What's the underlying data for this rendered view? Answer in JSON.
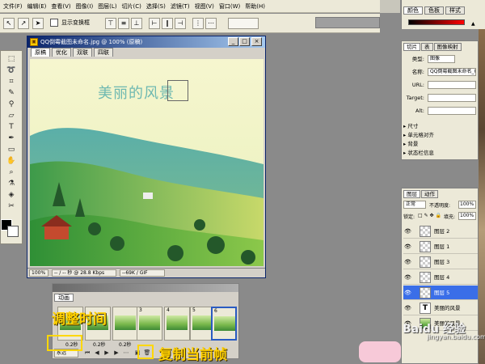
{
  "menubar": {
    "items": [
      "文件(F)",
      "编辑(E)",
      "查看(V)",
      "图像(I)",
      "图层(L)",
      "切片(C)",
      "选择(S)",
      "滤镜(T)",
      "视图(V)",
      "窗口(W)",
      "帮助(H)"
    ]
  },
  "options": {
    "checkbox_label": "显示变换框"
  },
  "document": {
    "title": "QQ倒霉截图未命名.jpg @ 100% (原稿)",
    "tabs": [
      "原稿",
      "优化",
      "双联",
      "四联"
    ],
    "canvas_text": "美丽的风景",
    "status": {
      "zoom": "100%",
      "time": "-- / -- 秒 @ 28.8 Kbps",
      "format": "--69K / GIF"
    }
  },
  "animation": {
    "tab_label": "动画",
    "frames": [
      {
        "num": "3",
        "delay": "0.2秒"
      },
      {
        "num": "4",
        "delay": "0.2秒"
      },
      {
        "num": "5",
        "delay": "0.2秒"
      },
      {
        "num": "6",
        "delay": "0.2秒"
      }
    ],
    "delays_visible": [
      "0.2秒",
      "0.2秒",
      "0.2秒"
    ],
    "loop_option": "永远"
  },
  "annotations": {
    "adjust_time": "调整时间",
    "duplicate_frame": "复制当前帧"
  },
  "color_panel": {
    "tabs": [
      "颜色",
      "色板",
      "样式"
    ]
  },
  "props_panel": {
    "tabs": [
      "切片",
      "表",
      "图像映射"
    ],
    "type_label": "类型:",
    "type_value": "图像",
    "name_label": "名称:",
    "name_value": "QQ倒霉截图未命名_01",
    "url_label": "URL:",
    "target_label": "Target:",
    "alt_label": "Alt:",
    "sections": [
      "尺寸",
      "单元格对齐",
      "背景",
      "状态栏信息"
    ]
  },
  "layers_panel": {
    "tabs": [
      "图层",
      "动作"
    ],
    "blend_mode": "正常",
    "opacity_label": "不透明度:",
    "opacity_value": "100%",
    "lock_label": "锁定:",
    "fill_label": "填充:",
    "fill_value": "100%",
    "layers": [
      {
        "name": "图层 2",
        "kind": "empty",
        "selected": false
      },
      {
        "name": "图层 1",
        "kind": "empty",
        "selected": false
      },
      {
        "name": "图层 3",
        "kind": "empty",
        "selected": false
      },
      {
        "name": "图层 4",
        "kind": "empty",
        "selected": false
      },
      {
        "name": "图层 5",
        "kind": "empty",
        "selected": true
      },
      {
        "name": "美丽的风景",
        "kind": "text",
        "selected": false
      },
      {
        "name": "美丽的风景",
        "kind": "image",
        "selected": false
      }
    ]
  },
  "watermark": {
    "text": "Baidu 经验",
    "sub": "jingyan.baidu.com"
  },
  "colors": {
    "accent": "#ffd700",
    "selection": "#3a6ee8",
    "titlebar": "#0a246a"
  }
}
